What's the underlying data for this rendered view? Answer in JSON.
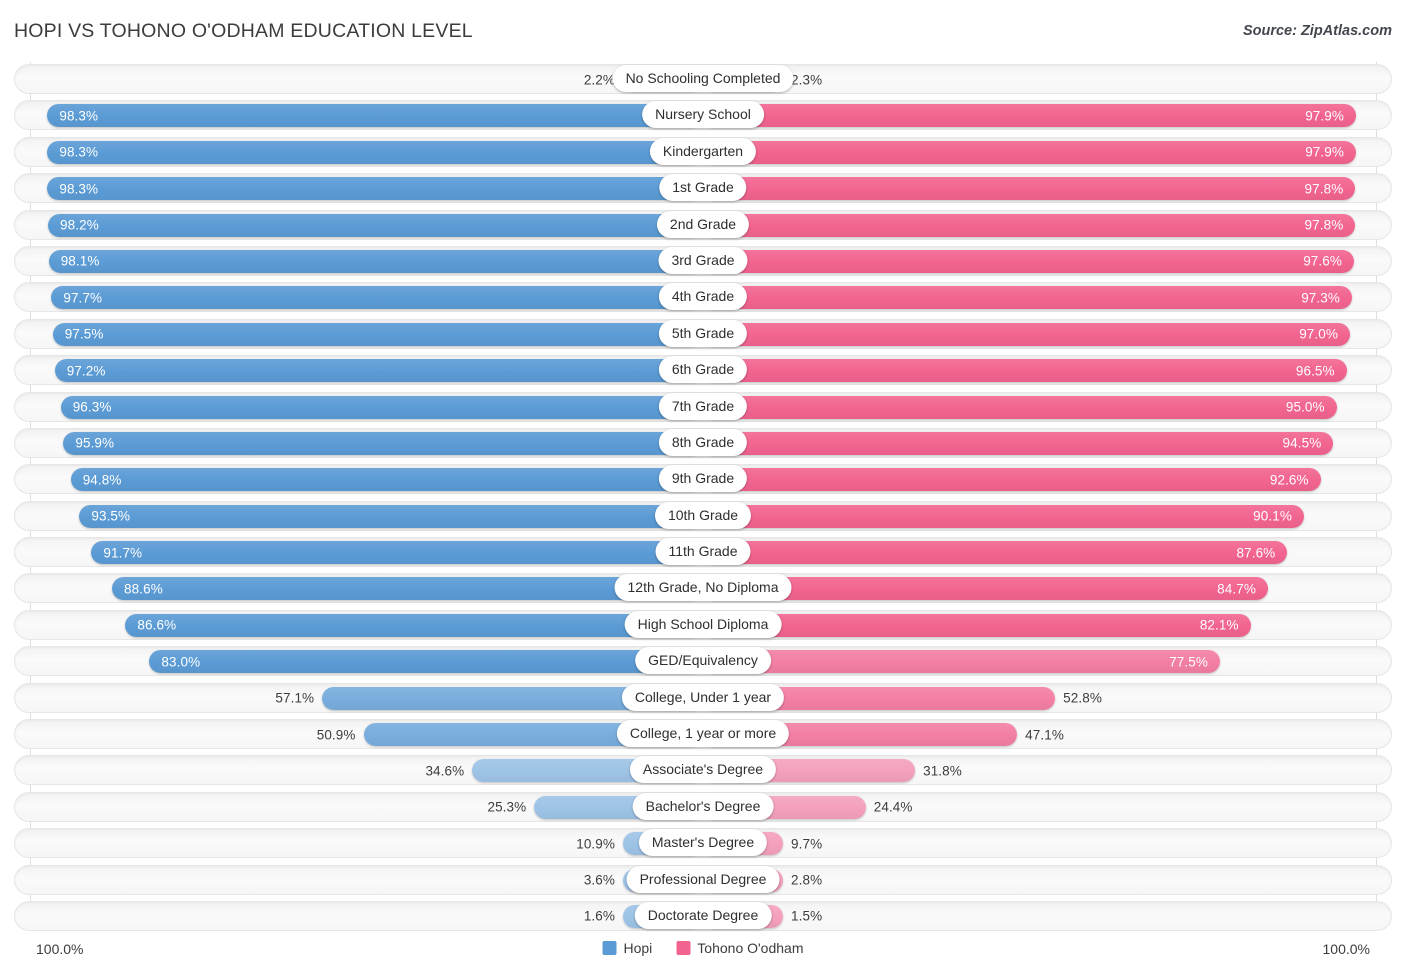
{
  "header": {
    "title": "HOPI VS TOHONO O'ODHAM EDUCATION LEVEL",
    "source": "Source: ZipAtlas.com"
  },
  "axis": {
    "left_max": "100.0%",
    "right_max": "100.0%"
  },
  "legend": [
    {
      "label": "Hopi",
      "color": "#5b9bd5"
    },
    {
      "label": "Tohono O'odham",
      "color": "#f2648f"
    }
  ],
  "colors": {
    "hopi_strong": "#5b9bd5",
    "hopi_light": "#9dc3e6",
    "tohono_strong": "#f2648f",
    "tohono_light": "#f4a0bc",
    "track": "#f5f5f5",
    "text": "#3c3c3c"
  },
  "chart_data": {
    "type": "bar",
    "orientation": "horizontal-diverging",
    "title": "HOPI VS TOHONO O'ODHAM EDUCATION LEVEL",
    "xlabel": "",
    "ylabel": "",
    "xlim": [
      0,
      100
    ],
    "grid": false,
    "legend_position": "bottom-center",
    "categories": [
      "No Schooling Completed",
      "Nursery School",
      "Kindergarten",
      "1st Grade",
      "2nd Grade",
      "3rd Grade",
      "4th Grade",
      "5th Grade",
      "6th Grade",
      "7th Grade",
      "8th Grade",
      "9th Grade",
      "10th Grade",
      "11th Grade",
      "12th Grade, No Diploma",
      "High School Diploma",
      "GED/Equivalency",
      "College, Under 1 year",
      "College, 1 year or more",
      "Associate's Degree",
      "Bachelor's Degree",
      "Master's Degree",
      "Professional Degree",
      "Doctorate Degree"
    ],
    "series": [
      {
        "name": "Hopi",
        "color": "#5b9bd5",
        "values": [
          2.2,
          98.3,
          98.3,
          98.3,
          98.2,
          98.1,
          97.7,
          97.5,
          97.2,
          96.3,
          95.9,
          94.8,
          93.5,
          91.7,
          88.6,
          86.6,
          83.0,
          57.1,
          50.9,
          34.6,
          25.3,
          10.9,
          3.6,
          1.6
        ],
        "labels": [
          "2.2%",
          "98.3%",
          "98.3%",
          "98.3%",
          "98.2%",
          "98.1%",
          "97.7%",
          "97.5%",
          "97.2%",
          "96.3%",
          "95.9%",
          "94.8%",
          "93.5%",
          "91.7%",
          "88.6%",
          "86.6%",
          "83.0%",
          "57.1%",
          "50.9%",
          "34.6%",
          "25.3%",
          "10.9%",
          "3.6%",
          "1.6%"
        ]
      },
      {
        "name": "Tohono O'odham",
        "color": "#f2648f",
        "values": [
          2.3,
          97.9,
          97.9,
          97.8,
          97.8,
          97.6,
          97.3,
          97.0,
          96.5,
          95.0,
          94.5,
          92.6,
          90.1,
          87.6,
          84.7,
          82.1,
          77.5,
          52.8,
          47.1,
          31.8,
          24.4,
          9.7,
          2.8,
          1.5
        ],
        "labels": [
          "2.3%",
          "97.9%",
          "97.9%",
          "97.8%",
          "97.8%",
          "97.6%",
          "97.3%",
          "97.0%",
          "96.5%",
          "95.0%",
          "94.5%",
          "92.6%",
          "90.1%",
          "87.6%",
          "84.7%",
          "82.1%",
          "77.5%",
          "52.8%",
          "47.1%",
          "31.8%",
          "24.4%",
          "9.7%",
          "2.8%",
          "1.5%"
        ]
      }
    ]
  }
}
